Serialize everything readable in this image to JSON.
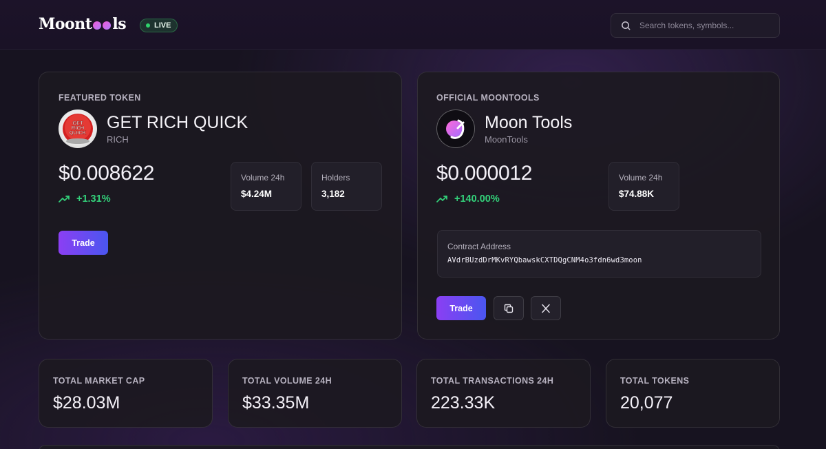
{
  "header": {
    "logo_text": "Moontools",
    "live_label": "LIVE",
    "search_placeholder": "Search tokens, symbols..."
  },
  "featured": {
    "section_label": "FEATURED TOKEN",
    "logo_text": [
      "GET",
      "RICH",
      "QUICK"
    ],
    "name": "GET RICH QUICK",
    "symbol": "RICH",
    "price": "$0.008622",
    "change": "+1.31%",
    "stats": [
      {
        "label": "Volume 24h",
        "value": "$4.24M"
      },
      {
        "label": "Holders",
        "value": "3,182"
      }
    ],
    "trade_label": "Trade"
  },
  "official": {
    "section_label": "OFFICIAL MOONTOOLS",
    "name": "Moon Tools",
    "symbol": "MoonTools",
    "price": "$0.000012",
    "change": "+140.00%",
    "stats": [
      {
        "label": "Volume 24h",
        "value": "$74.88K"
      }
    ],
    "contract_label": "Contract Address",
    "contract_address": "AVdrBUzdDrMKvRYQbawskCXTDQgCNM4o3fdn6wd3moon",
    "trade_label": "Trade"
  },
  "metrics": [
    {
      "label": "TOTAL MARKET CAP",
      "value": "$28.03M"
    },
    {
      "label": "TOTAL VOLUME 24H",
      "value": "$33.35M"
    },
    {
      "label": "TOTAL TRANSACTIONS 24H",
      "value": "223.33K"
    },
    {
      "label": "TOTAL TOKENS",
      "value": "20,077"
    }
  ],
  "colors": {
    "accent_purple": "#8b3ff3",
    "accent_blue": "#4a56f0",
    "positive": "#33d17a",
    "live": "#2fd36c"
  },
  "icons": {
    "search": "search-icon",
    "trend": "trending-up-icon",
    "copy": "copy-icon",
    "x": "x-logo-icon"
  }
}
